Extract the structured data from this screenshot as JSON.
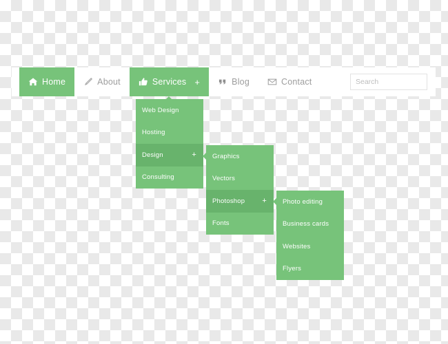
{
  "navbar": {
    "items": [
      {
        "label": "Home",
        "icon": "home-icon",
        "state": "active",
        "has_plus": false
      },
      {
        "label": "About",
        "icon": "pencil-icon",
        "state": "normal",
        "has_plus": false
      },
      {
        "label": "Services",
        "icon": "thumbs-up-icon",
        "state": "active",
        "has_plus": true,
        "plus": "+"
      },
      {
        "label": "Blog",
        "icon": "quote-icon",
        "state": "normal",
        "has_plus": false
      },
      {
        "label": "Contact",
        "icon": "envelope-icon",
        "state": "normal",
        "has_plus": false
      }
    ],
    "search": {
      "placeholder": "Search",
      "value": ""
    }
  },
  "menus": {
    "services": {
      "items": [
        {
          "label": "Web Design",
          "state": "normal",
          "has_plus": false
        },
        {
          "label": "Hosting",
          "state": "normal",
          "has_plus": false
        },
        {
          "label": "Design",
          "state": "hover",
          "has_plus": true,
          "plus": "+"
        },
        {
          "label": "Consulting",
          "state": "normal",
          "has_plus": false
        }
      ]
    },
    "design": {
      "items": [
        {
          "label": "Graphics",
          "state": "normal",
          "has_plus": false
        },
        {
          "label": "Vectors",
          "state": "normal",
          "has_plus": false
        },
        {
          "label": "Photoshop",
          "state": "hover",
          "has_plus": true,
          "plus": "+"
        },
        {
          "label": "Fonts",
          "state": "normal",
          "has_plus": false
        }
      ]
    },
    "photoshop": {
      "items": [
        {
          "label": "Photo editing",
          "state": "normal",
          "has_plus": false
        },
        {
          "label": "Business cards",
          "state": "normal",
          "has_plus": false
        },
        {
          "label": "Websites",
          "state": "normal",
          "has_plus": false
        },
        {
          "label": "Flyers",
          "state": "normal",
          "has_plus": false
        }
      ]
    }
  },
  "colors": {
    "green": "#77c37a",
    "green_hover": "#68b36c",
    "bar_background": "#ffffff",
    "inactive_text": "#9d9d9d",
    "active_text": "#ffffff",
    "border": "#e2e2e2"
  }
}
